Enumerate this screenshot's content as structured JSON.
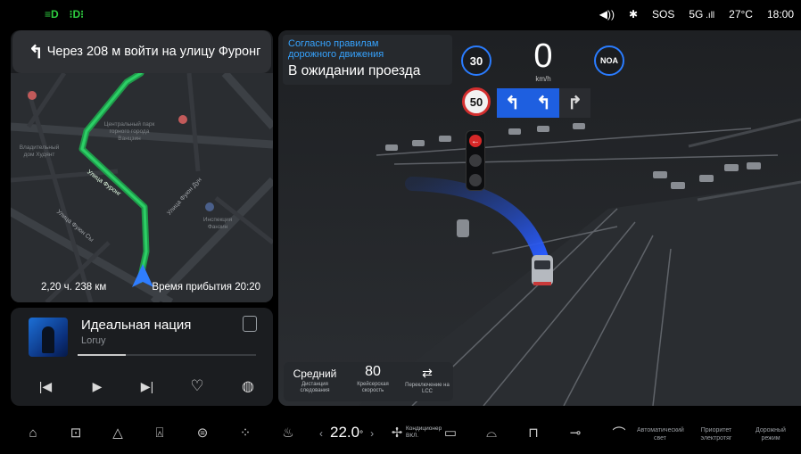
{
  "status_bar": {
    "left_icons": [
      "headlight-icon",
      "parking-light-icon"
    ],
    "volume_icon": "volume-icon",
    "bluetooth_icon": "bluetooth-icon",
    "sos": "SOS",
    "network": "5G",
    "temperature": "27°C",
    "time": "18:00"
  },
  "navigation": {
    "instruction": "Через 208 м войти на улицу Фуронг",
    "map_labels": {
      "poi_1": "Центральный парк горного города Ванцзин",
      "poi_2": "Владительный дом Худянт",
      "poi_3": "Инспекция Фанзин",
      "street_1": "Улица Фуронг",
      "street_2": "Улица Фуюн Сы",
      "street_3": "Улица Фуюн Дун"
    },
    "remaining": "2,20 ч. 238 км",
    "arrival": "Время прибытия 20:20"
  },
  "music": {
    "title": "Идеальная нация",
    "artist": "Loruy",
    "progress": 0.27,
    "controls": [
      "previous-icon",
      "play-icon",
      "next-icon",
      "heart-icon",
      "globe-icon"
    ]
  },
  "adas": {
    "notice_sub": "Согласно правилам дорожного движения",
    "notice_main": "В ожидании проезда",
    "speed_limit_current": "30",
    "speed": "0",
    "speed_unit": "km/h",
    "noa": "NOA",
    "speed_limit_sign": "50",
    "lanes": [
      {
        "icon": "turn-left-icon",
        "active": true
      },
      {
        "icon": "turn-left-icon",
        "active": true
      },
      {
        "icon": "turn-right-icon",
        "active": false
      }
    ],
    "follow": {
      "distance_value": "Средний",
      "distance_label": "Дистанция следования",
      "cruise_value": "80",
      "cruise_label": "Крейсерская скорость",
      "lcc_label": "Переключение на LCC"
    }
  },
  "dock": {
    "temperature": "22.0",
    "temp_unit": "°",
    "ac_label": "Кондиционер ВКЛ.",
    "auto_light": "Автоматический свет",
    "priority": "Приоритет электротяг",
    "road_mode": "Дорожный режим"
  },
  "colors": {
    "route": "#1db954",
    "accent_blue": "#2a7cff",
    "lane_active": "#1e5fe0",
    "limit_red": "#d32f2f"
  }
}
